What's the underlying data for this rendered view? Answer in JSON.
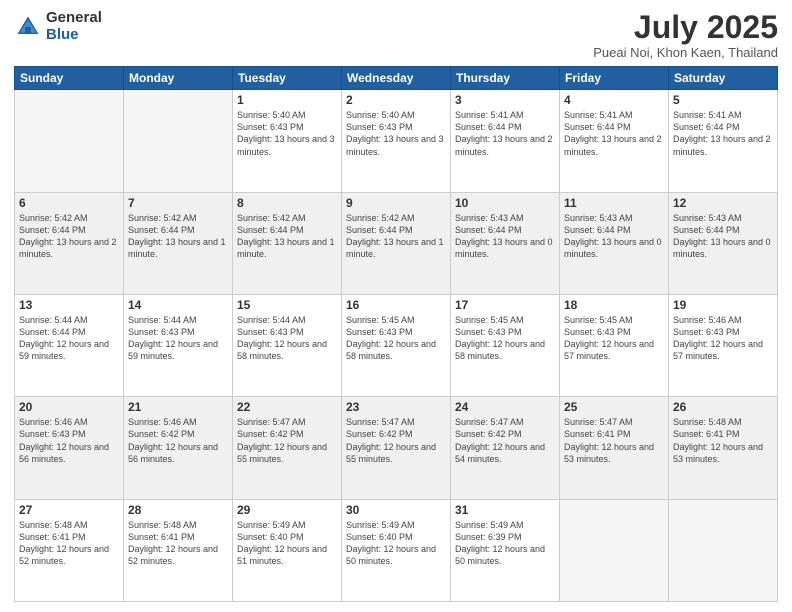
{
  "logo": {
    "general": "General",
    "blue": "Blue"
  },
  "header": {
    "month": "July 2025",
    "location": "Pueai Noi, Khon Kaen, Thailand"
  },
  "days_of_week": [
    "Sunday",
    "Monday",
    "Tuesday",
    "Wednesday",
    "Thursday",
    "Friday",
    "Saturday"
  ],
  "weeks": [
    [
      {
        "day": "",
        "info": ""
      },
      {
        "day": "",
        "info": ""
      },
      {
        "day": "1",
        "info": "Sunrise: 5:40 AM\nSunset: 6:43 PM\nDaylight: 13 hours and 3 minutes."
      },
      {
        "day": "2",
        "info": "Sunrise: 5:40 AM\nSunset: 6:43 PM\nDaylight: 13 hours and 3 minutes."
      },
      {
        "day": "3",
        "info": "Sunrise: 5:41 AM\nSunset: 6:44 PM\nDaylight: 13 hours and 2 minutes."
      },
      {
        "day": "4",
        "info": "Sunrise: 5:41 AM\nSunset: 6:44 PM\nDaylight: 13 hours and 2 minutes."
      },
      {
        "day": "5",
        "info": "Sunrise: 5:41 AM\nSunset: 6:44 PM\nDaylight: 13 hours and 2 minutes."
      }
    ],
    [
      {
        "day": "6",
        "info": "Sunrise: 5:42 AM\nSunset: 6:44 PM\nDaylight: 13 hours and 2 minutes."
      },
      {
        "day": "7",
        "info": "Sunrise: 5:42 AM\nSunset: 6:44 PM\nDaylight: 13 hours and 1 minute."
      },
      {
        "day": "8",
        "info": "Sunrise: 5:42 AM\nSunset: 6:44 PM\nDaylight: 13 hours and 1 minute."
      },
      {
        "day": "9",
        "info": "Sunrise: 5:42 AM\nSunset: 6:44 PM\nDaylight: 13 hours and 1 minute."
      },
      {
        "day": "10",
        "info": "Sunrise: 5:43 AM\nSunset: 6:44 PM\nDaylight: 13 hours and 0 minutes."
      },
      {
        "day": "11",
        "info": "Sunrise: 5:43 AM\nSunset: 6:44 PM\nDaylight: 13 hours and 0 minutes."
      },
      {
        "day": "12",
        "info": "Sunrise: 5:43 AM\nSunset: 6:44 PM\nDaylight: 13 hours and 0 minutes."
      }
    ],
    [
      {
        "day": "13",
        "info": "Sunrise: 5:44 AM\nSunset: 6:44 PM\nDaylight: 12 hours and 59 minutes."
      },
      {
        "day": "14",
        "info": "Sunrise: 5:44 AM\nSunset: 6:43 PM\nDaylight: 12 hours and 59 minutes."
      },
      {
        "day": "15",
        "info": "Sunrise: 5:44 AM\nSunset: 6:43 PM\nDaylight: 12 hours and 58 minutes."
      },
      {
        "day": "16",
        "info": "Sunrise: 5:45 AM\nSunset: 6:43 PM\nDaylight: 12 hours and 58 minutes."
      },
      {
        "day": "17",
        "info": "Sunrise: 5:45 AM\nSunset: 6:43 PM\nDaylight: 12 hours and 58 minutes."
      },
      {
        "day": "18",
        "info": "Sunrise: 5:45 AM\nSunset: 6:43 PM\nDaylight: 12 hours and 57 minutes."
      },
      {
        "day": "19",
        "info": "Sunrise: 5:46 AM\nSunset: 6:43 PM\nDaylight: 12 hours and 57 minutes."
      }
    ],
    [
      {
        "day": "20",
        "info": "Sunrise: 5:46 AM\nSunset: 6:43 PM\nDaylight: 12 hours and 56 minutes."
      },
      {
        "day": "21",
        "info": "Sunrise: 5:46 AM\nSunset: 6:42 PM\nDaylight: 12 hours and 56 minutes."
      },
      {
        "day": "22",
        "info": "Sunrise: 5:47 AM\nSunset: 6:42 PM\nDaylight: 12 hours and 55 minutes."
      },
      {
        "day": "23",
        "info": "Sunrise: 5:47 AM\nSunset: 6:42 PM\nDaylight: 12 hours and 55 minutes."
      },
      {
        "day": "24",
        "info": "Sunrise: 5:47 AM\nSunset: 6:42 PM\nDaylight: 12 hours and 54 minutes."
      },
      {
        "day": "25",
        "info": "Sunrise: 5:47 AM\nSunset: 6:41 PM\nDaylight: 12 hours and 53 minutes."
      },
      {
        "day": "26",
        "info": "Sunrise: 5:48 AM\nSunset: 6:41 PM\nDaylight: 12 hours and 53 minutes."
      }
    ],
    [
      {
        "day": "27",
        "info": "Sunrise: 5:48 AM\nSunset: 6:41 PM\nDaylight: 12 hours and 52 minutes."
      },
      {
        "day": "28",
        "info": "Sunrise: 5:48 AM\nSunset: 6:41 PM\nDaylight: 12 hours and 52 minutes."
      },
      {
        "day": "29",
        "info": "Sunrise: 5:49 AM\nSunset: 6:40 PM\nDaylight: 12 hours and 51 minutes."
      },
      {
        "day": "30",
        "info": "Sunrise: 5:49 AM\nSunset: 6:40 PM\nDaylight: 12 hours and 50 minutes."
      },
      {
        "day": "31",
        "info": "Sunrise: 5:49 AM\nSunset: 6:39 PM\nDaylight: 12 hours and 50 minutes."
      },
      {
        "day": "",
        "info": ""
      },
      {
        "day": "",
        "info": ""
      }
    ]
  ]
}
